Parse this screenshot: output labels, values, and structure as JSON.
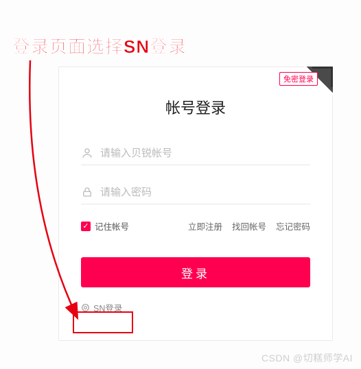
{
  "annotation": "登录页面选择SN登录",
  "card": {
    "corner_badge": "免密登录",
    "title": "帐号登录",
    "username_placeholder": "请输入贝锐帐号",
    "password_placeholder": "请输入密码",
    "remember_label": "记住帐号",
    "links": {
      "register": "立即注册",
      "find_account": "找回帐号",
      "forgot_password": "忘记密码"
    },
    "login_button": "登录",
    "sn_login": "SN登录"
  },
  "colors": {
    "accent": "#ff0050",
    "annotation": "#e60012"
  },
  "watermark": "CSDN @切糕师学AI"
}
